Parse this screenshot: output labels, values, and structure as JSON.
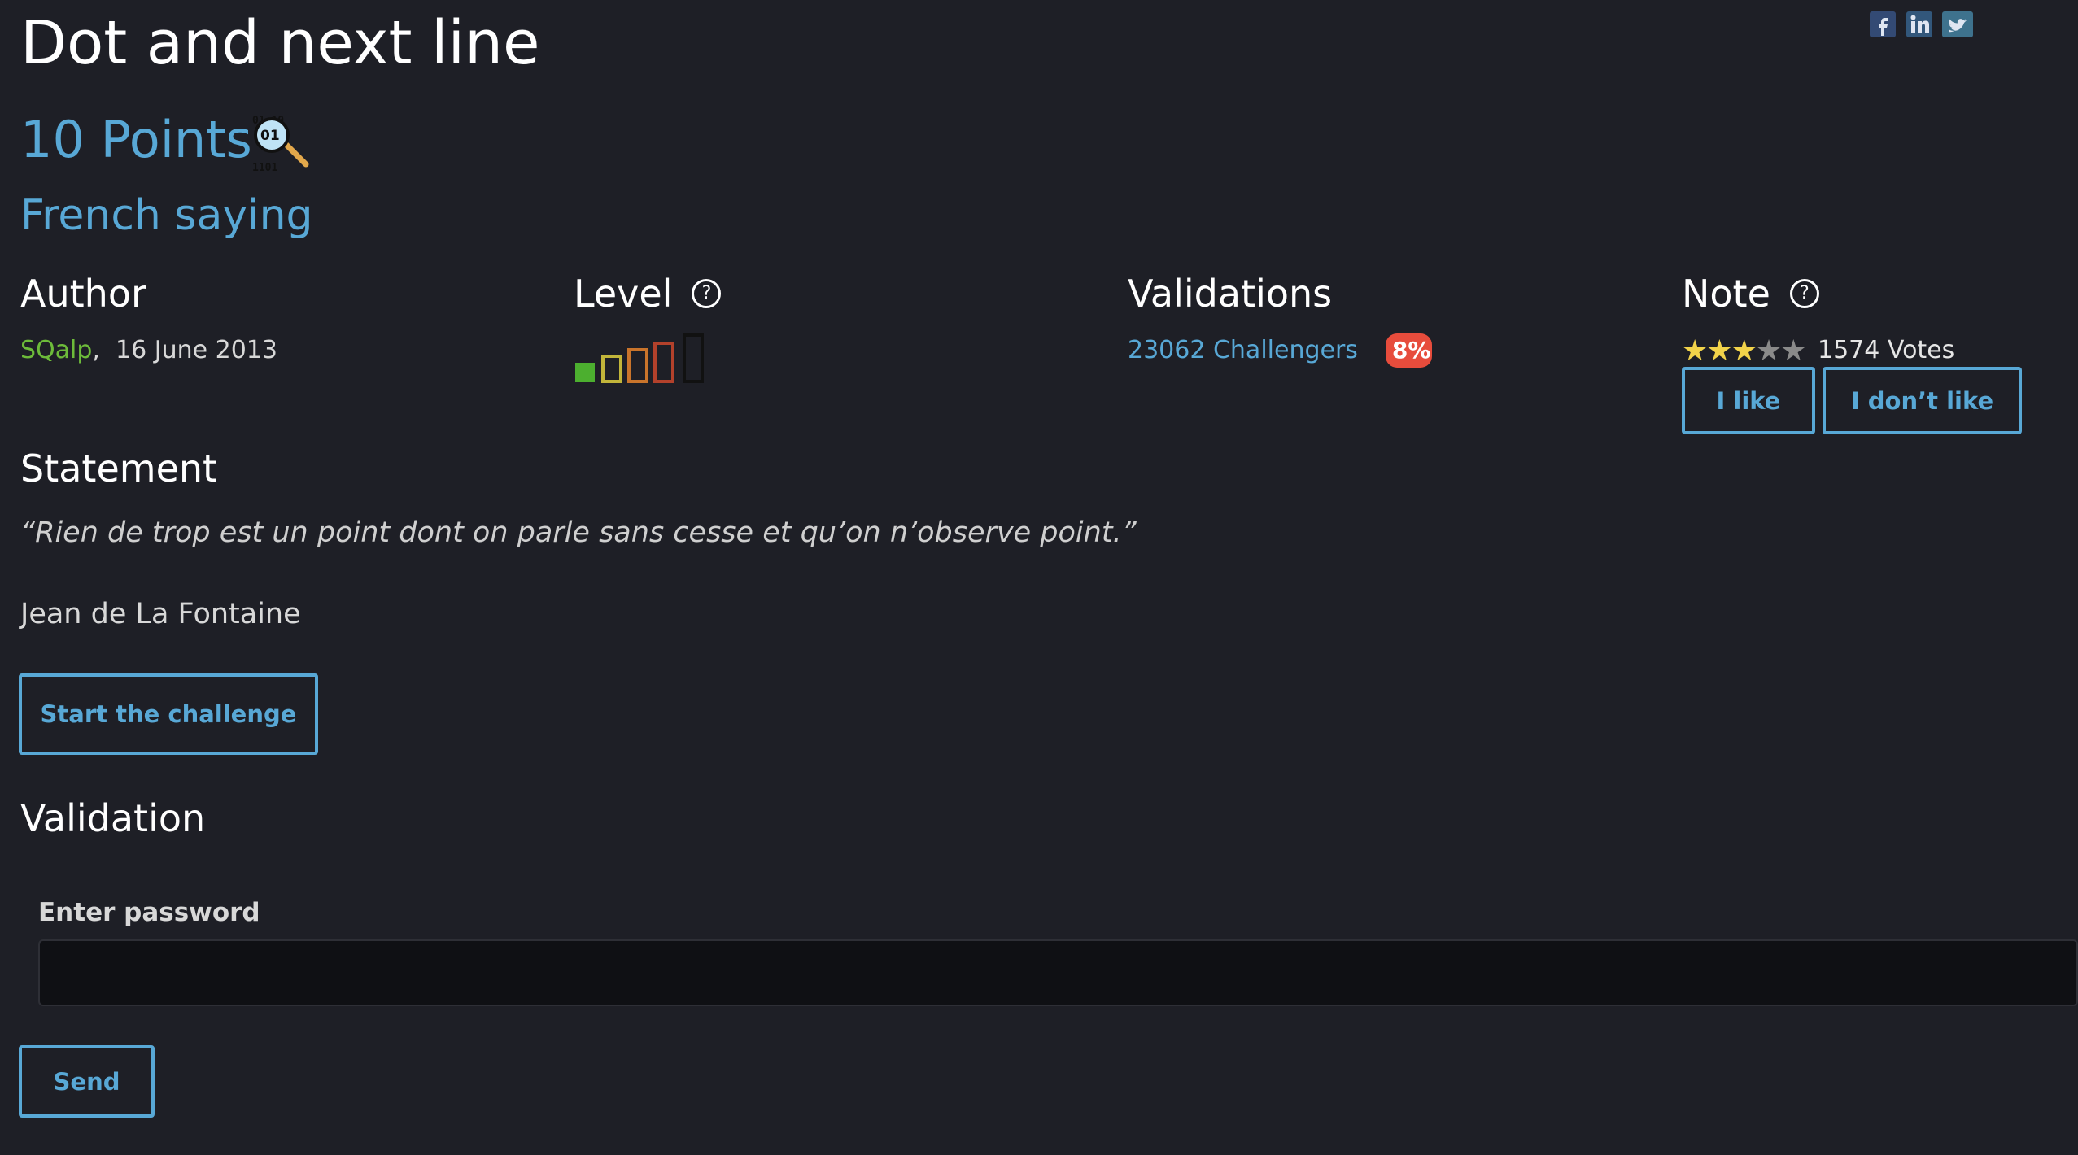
{
  "challenge": {
    "title": "Dot and next line",
    "points": "10 Points",
    "category": "French saying",
    "category_icon": "steganography-magnifier-icon"
  },
  "social": {
    "icons": [
      "facebook-icon",
      "linkedin-icon",
      "twitter-icon"
    ]
  },
  "author": {
    "heading": "Author",
    "name": "SQalp",
    "separator": ",",
    "date": "16 June 2013"
  },
  "level": {
    "heading": "Level",
    "help_glyph": "?",
    "value": 1,
    "max": 5
  },
  "validations": {
    "heading": "Validations",
    "challengers": "23062 Challengers",
    "percent": "8%"
  },
  "note": {
    "heading": "Note",
    "help_glyph": "?",
    "rating": 3,
    "max": 5,
    "votes": "1574 Votes",
    "like_label": "I like",
    "dislike_label": "I don’t like"
  },
  "statement": {
    "heading": "Statement",
    "quote": "“Rien de trop est un point dont on parle sans cesse et qu’on n’observe point.”",
    "attribution": "Jean de La Fontaine",
    "start_label": "Start the challenge"
  },
  "validation": {
    "heading": "Validation",
    "password_label": "Enter password",
    "password_value": "",
    "send_label": "Send"
  },
  "colors": {
    "background": "#1e1f26",
    "accent": "#58a8d6",
    "author": "#6dbb3a",
    "badge": "#e74c3c",
    "star_on": "#f2d34a"
  }
}
